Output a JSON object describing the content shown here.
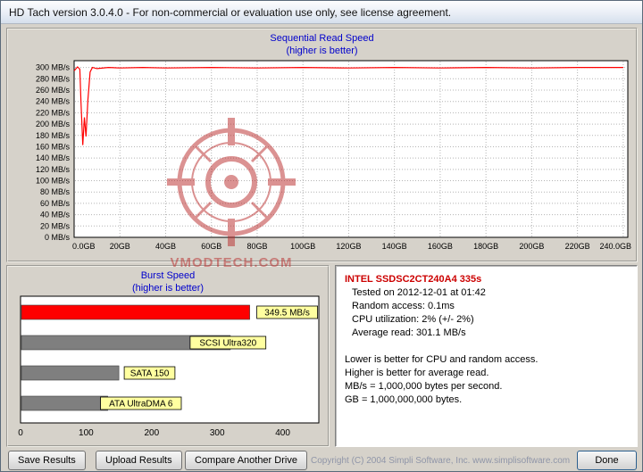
{
  "window": {
    "title": "HD Tach version 3.0.4.0  - For non-commercial or evaluation use only, see license agreement."
  },
  "chart_data": [
    {
      "type": "line",
      "title": "Sequential Read Speed",
      "subtitle": "(higher is better)",
      "xlabel": "GB",
      "ylabel": "MB/s",
      "xlim": [
        0,
        240
      ],
      "ylim": [
        0,
        300
      ],
      "grid": "dotted",
      "line_color": "#ff0000",
      "y_tick_values": [
        300,
        280,
        260,
        240,
        220,
        200,
        180,
        160,
        140,
        120,
        100,
        80,
        60,
        40,
        20,
        0
      ],
      "y_tick_labels": [
        "300 MB/s",
        "280 MB/s",
        "260 MB/s",
        "240 MB/s",
        "220 MB/s",
        "200 MB/s",
        "180 MB/s",
        "160 MB/s",
        "140 MB/s",
        "120 MB/s",
        "100 MB/s",
        "80 MB/s",
        "60 MB/s",
        "40 MB/s",
        "20 MB/s",
        "0 MB/s"
      ],
      "x_tick_values": [
        0,
        20,
        40,
        60,
        80,
        100,
        120,
        140,
        160,
        180,
        200,
        220,
        240
      ],
      "x_tick_labels": [
        "0.0GB",
        "20GB",
        "40GB",
        "60GB",
        "80GB",
        "100GB",
        "120GB",
        "140GB",
        "160GB",
        "180GB",
        "200GB",
        "220GB",
        "240.0GB"
      ],
      "series": [
        {
          "name": "Sequential read speed",
          "points": [
            [
              0,
              294
            ],
            [
              1.5,
              301
            ],
            [
              2.5,
              297
            ],
            [
              3,
              238
            ],
            [
              3.8,
              163
            ],
            [
              4.5,
              212
            ],
            [
              5.2,
              178
            ],
            [
              6,
              242
            ],
            [
              7,
              292
            ],
            [
              8,
              300
            ],
            [
              10,
              298
            ],
            [
              15,
              300
            ],
            [
              20,
              299
            ],
            [
              30,
              300
            ],
            [
              40,
              299
            ],
            [
              60,
              300
            ],
            [
              80,
              299
            ],
            [
              100,
              300
            ],
            [
              120,
              299
            ],
            [
              140,
              300
            ],
            [
              160,
              299
            ],
            [
              180,
              300
            ],
            [
              200,
              299
            ],
            [
              220,
              300
            ],
            [
              240,
              300
            ]
          ]
        }
      ]
    },
    {
      "type": "bar",
      "title": "Burst Speed",
      "subtitle": "(higher is better)",
      "categories": [
        "This drive",
        "SCSI Ultra320",
        "SATA 150",
        "ATA UltraDMA 6"
      ],
      "values": [
        349.5,
        320,
        150,
        133
      ],
      "bar_labels": [
        "349.5 MB/s",
        "SCSI Ultra320",
        "SATA 150",
        "ATA UltraDMA 6"
      ],
      "bar_colors": [
        "#ff0000",
        "#7f7f7f",
        "#7f7f7f",
        "#7f7f7f"
      ],
      "label_bg": "#ffffa0",
      "x_tick_values": [
        0,
        100,
        200,
        300,
        400
      ],
      "x_tick_labels": [
        "0",
        "100",
        "200",
        "300",
        "400"
      ],
      "xlim": [
        0,
        455
      ]
    }
  ],
  "info_panel": {
    "drive": "INTEL SSDSC2CT240A4 335s",
    "lines": [
      "Tested on 2012-12-01 at 01:42",
      "Random access: 0.1ms",
      "CPU utilization: 2% (+/- 2%)",
      "Average read: 301.1 MB/s"
    ],
    "notes": [
      "Lower is better for CPU and random access.",
      "Higher is better for average read.",
      "MB/s = 1,000,000 bytes per second.",
      "GB = 1,000,000,000 bytes."
    ]
  },
  "buttons": {
    "save": "Save Results",
    "upload": "Upload Results",
    "compare": "Compare Another Drive",
    "done": "Done"
  },
  "footer": {
    "copyright": "Copyright (C) 2004 Simpli Software, Inc.  www.simplisoftware.com"
  },
  "watermark": {
    "text": "VMODTECH.COM"
  },
  "colors": {
    "chart_title": "#0000cc",
    "drive_title": "#cc0000",
    "watermark": "#b82828"
  }
}
